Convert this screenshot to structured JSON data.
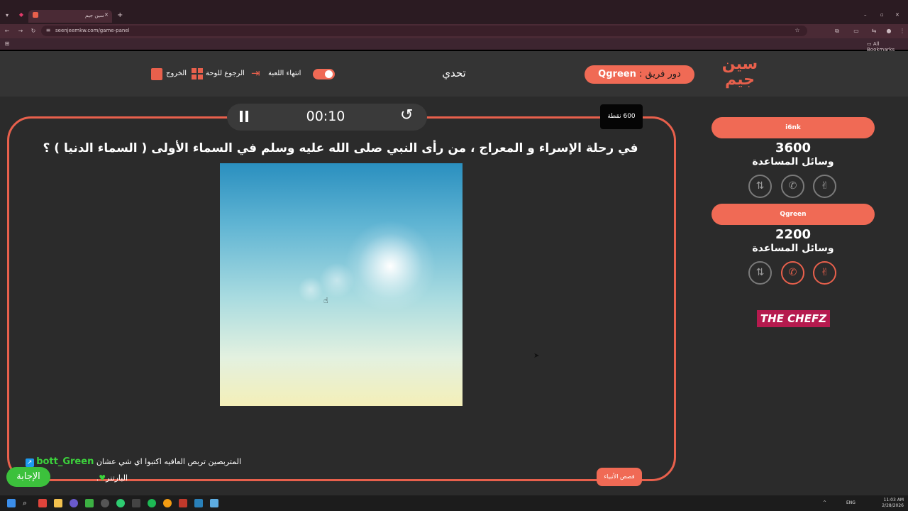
{
  "browser": {
    "tab_title": "سين جيم",
    "url": "seenjeemkw.com/game-panel",
    "all_bookmarks": "All Bookmarks"
  },
  "header": {
    "logo_text": "سين جيم",
    "turn_label": "دور فريق :",
    "turn_team": "Qgreen",
    "title": "تحدي",
    "end_game": "انتهاء اللعبة",
    "back_to_board": "الرجوع للوحة",
    "exit": "الخروج"
  },
  "question": {
    "timer": "00:10",
    "points": "600 نقطة",
    "text": "في رحلة الإسراء و المعراج ، من رأى النبي صلى الله عليه وسلم في السماء الأولى ( السماء الدنيا ) ؟",
    "category": "قصص الأنبياء",
    "answer_button": "الإجابة"
  },
  "chat": {
    "username": "bott_Green",
    "message_line1": "المتربصين تربص العافيه اكتبوا اي شي عشان",
    "message_line2": "البارتنر"
  },
  "teams": [
    {
      "name": "i6nk",
      "score": "3600",
      "aids_label": "وسائل المساعدة",
      "aids_active": [
        false,
        false,
        false
      ]
    },
    {
      "name": "Qgreen",
      "score": "2200",
      "aids_label": "وسائل المساعدة",
      "aids_active": [
        false,
        true,
        true
      ]
    }
  ],
  "sponsor": "THE CHEFZ",
  "taskbar": {
    "lang": "ENG",
    "time": "11:03 AM",
    "date": "2/28/2026"
  },
  "colors": {
    "accent": "#f06a55",
    "frame": "#e8604c",
    "answer_green": "#3cc13c",
    "sponsor": "#b51a4e"
  }
}
